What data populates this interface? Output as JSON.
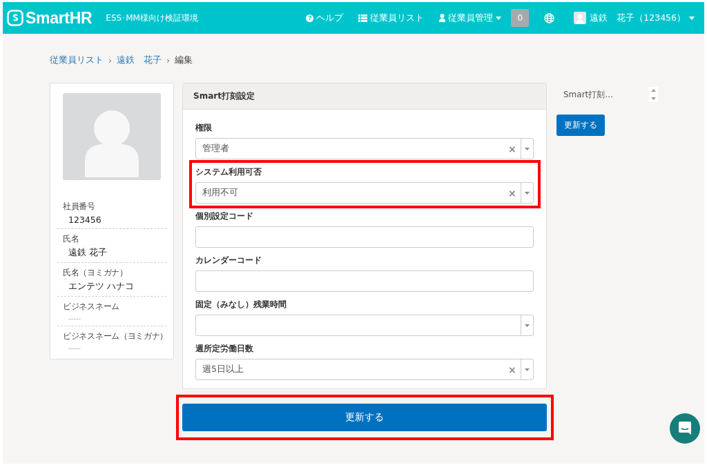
{
  "header": {
    "logo": "SmartHR",
    "environment": "ESS･MM様向け検証環境",
    "nav": [
      {
        "kind": "help",
        "icon": "?",
        "label": "ヘルプ"
      },
      {
        "kind": "list",
        "label": "従業員リスト"
      },
      {
        "kind": "person",
        "label": "従業員管理",
        "dropdown": true
      }
    ],
    "notification_count": "0",
    "user": "遠鉄　花子（123456）"
  },
  "breadcrumb_separator": "›",
  "clear_symbol": "×",
  "breadcrumb": [
    {
      "label": "従業員リスト",
      "link": true
    },
    {
      "label": "遠鉄　花子",
      "link": true
    },
    {
      "label": "編集",
      "link": false
    }
  ],
  "profile": {
    "fields": [
      {
        "label": "社員番号",
        "value": "123456",
        "empty": false
      },
      {
        "label": "氏名",
        "value": "遠鉄 花子",
        "empty": false
      },
      {
        "label": "氏名（ヨミガナ）",
        "value": "エンテツ ハナコ",
        "empty": false
      },
      {
        "label": "ビジネスネーム",
        "value": "-----",
        "empty": true
      },
      {
        "label": "ビジネスネーム（ヨミガナ）",
        "value": "-----",
        "empty": true
      }
    ]
  },
  "form": {
    "title": "Smart打刻設定",
    "fields": [
      {
        "label": "権限",
        "kind": "select",
        "value": "管理者",
        "highlighted": false
      },
      {
        "label": "システム利用可否",
        "kind": "select",
        "value": "利用不可",
        "highlighted": true
      },
      {
        "label": "個別設定コード",
        "kind": "text",
        "highlighted": false
      },
      {
        "label": "カレンダーコード",
        "kind": "text",
        "highlighted": false
      },
      {
        "label": "固定（みなし）残業時間",
        "kind": "select",
        "highlighted": false
      },
      {
        "label": "週所定労働日数",
        "kind": "select",
        "value": "週5日以上",
        "highlighted": false
      }
    ],
    "submit": {
      "label": "更新する",
      "highlighted": true
    }
  },
  "side": {
    "section": "Smart打刻...",
    "button": "更新する"
  }
}
